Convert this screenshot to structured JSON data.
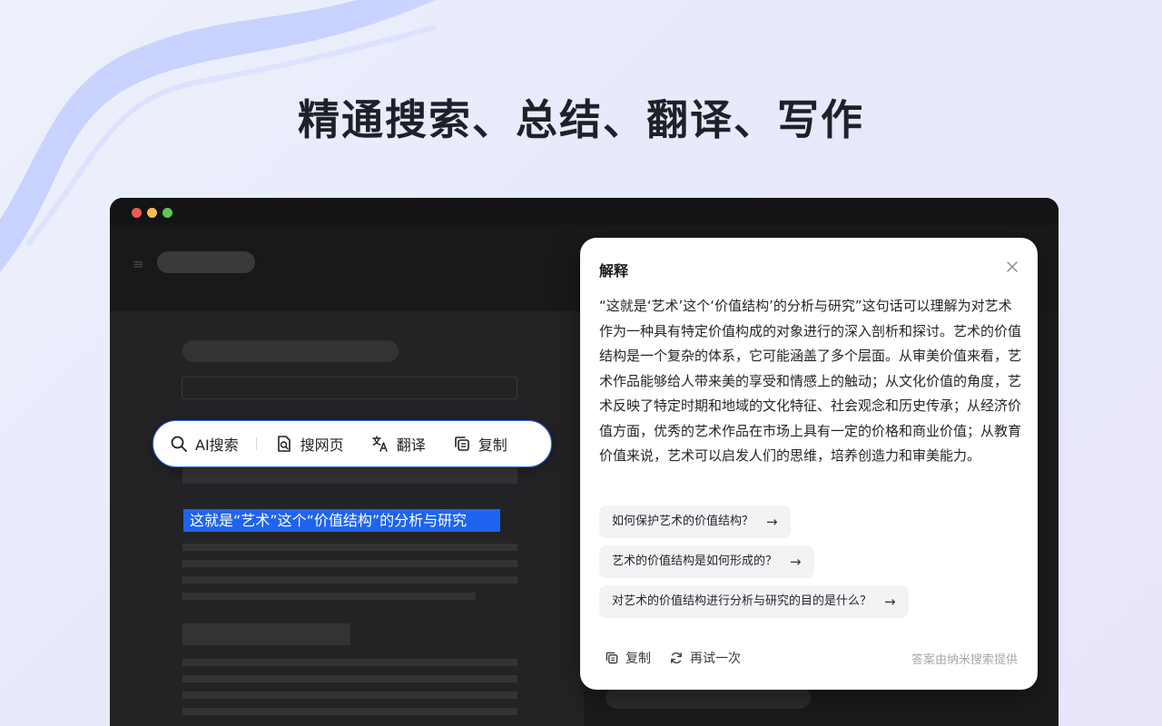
{
  "headline": "精通搜索、总结、翻译、写作",
  "toolbar": {
    "ai_search": "AI搜索",
    "search_web": "搜网页",
    "translate": "翻译",
    "copy": "复制"
  },
  "selected_text": "这就是“艺术”这个“价值结构”的分析与研究",
  "panel": {
    "title": "解释",
    "answer": "“这就是‘艺术’这个‘价值结构’的分析与研究”这句话可以理解为对艺术作为一种具有特定价值构成的对象进行的深入剖析和探讨。艺术的价值结构是一个复杂的体系，它可能涵盖了多个层面。从审美价值来看，艺术作品能够给人带来美的享受和情感上的触动；从文化价值的角度，艺术反映了特定时期和地域的文化特征、社会观念和历史传承；从经济价值方面，优秀的艺术作品在市场上具有一定的价格和商业价值；从教育价值来说，艺术可以启发人们的思维，培养创造力和审美能力。",
    "suggestions": [
      "如何保护艺术的价值结构？",
      "艺术的价值结构是如何形成的？",
      "对艺术的价值结构进行分析与研究的目的是什么？"
    ],
    "arrow": "→",
    "copy_label": "复制",
    "retry_label": "再试一次",
    "credit": "答案由纳米搜索提供"
  },
  "icons": {
    "menu": "≡",
    "close": "close-icon",
    "search": "search-icon",
    "web": "web-page-search-icon",
    "translate": "translate-icon",
    "copy": "copy-icon",
    "retry": "refresh-icon"
  },
  "colors": {
    "accent": "#1f64f0",
    "window_bg": "#1c1c1e",
    "panel_bg": "#ffffff"
  }
}
